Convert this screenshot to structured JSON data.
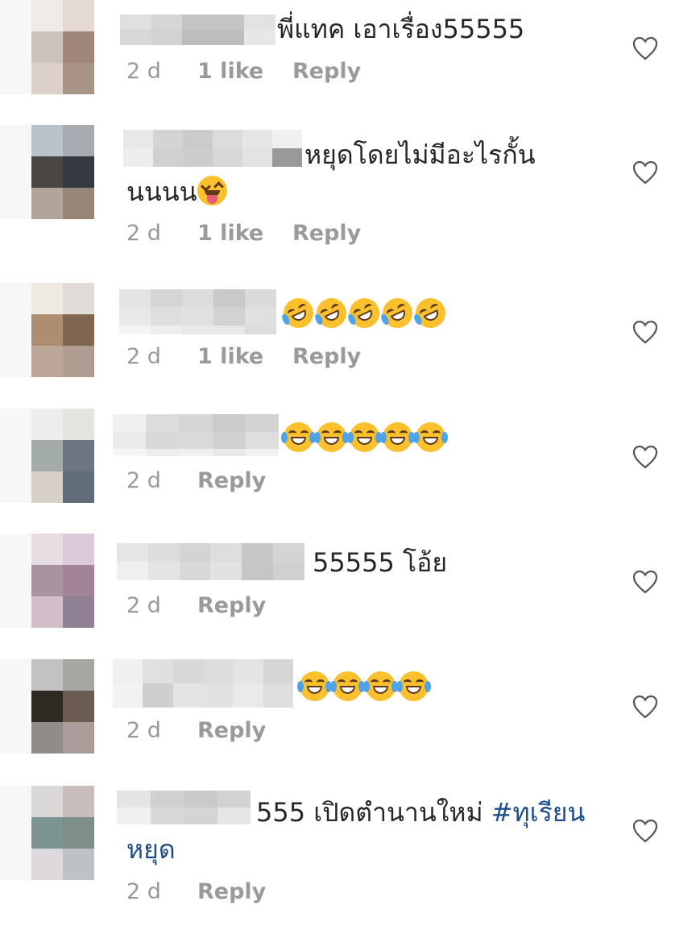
{
  "comments": [
    {
      "line1": "พี่แทค เอาเรื่อง55555",
      "date": "2 d",
      "likes": "1 like",
      "reply": "Reply"
    },
    {
      "line1": "หยุดโดยไม่มีอะไรกั้น",
      "line2": "นนนน",
      "date": "2 d",
      "likes": "1 like",
      "reply": "Reply"
    },
    {
      "line1": "",
      "date": "2 d",
      "likes": "1 like",
      "reply": "Reply"
    },
    {
      "line1": "",
      "date": "2 d",
      "reply": "Reply"
    },
    {
      "line1": "55555 โอ้ย",
      "date": "2 d",
      "reply": "Reply"
    },
    {
      "line1": "",
      "date": "2 d",
      "reply": "Reply"
    },
    {
      "line1": "555 เปิดตำนานใหม่ ",
      "hashtag": "#ทุเรียน",
      "line2": "หยุด",
      "date": "2 d",
      "reply": "Reply"
    }
  ],
  "icons": {
    "heart": "heart-outline-icon",
    "emoji_tongue": "squinting-face-with-tongue-icon",
    "emoji_rofl": "rolling-on-floor-laughing-icon",
    "emoji_joy": "face-with-tears-of-joy-icon"
  },
  "colors": {
    "text": "#262626",
    "meta": "#9a9a9a",
    "hashtag": "#1f4d8a"
  }
}
